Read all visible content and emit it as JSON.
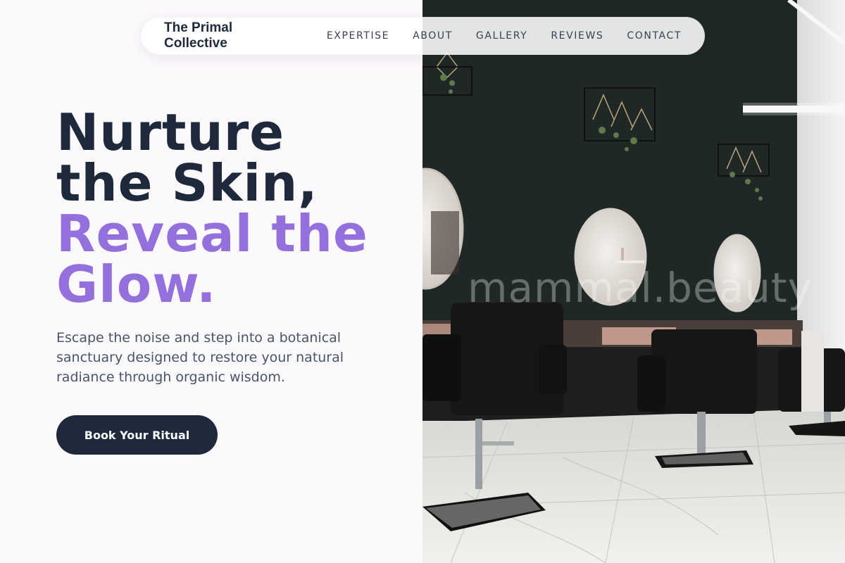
{
  "nav": {
    "brand": "The Primal Collective",
    "links": [
      "EXPERTISE",
      "ABOUT",
      "GALLERY",
      "REVIEWS",
      "CONTACT"
    ]
  },
  "hero": {
    "title_line1": "Nurture",
    "title_line2": "the Skin,",
    "title_accent_line1": "Reveal the",
    "title_accent_line2": "Glow.",
    "subtitle": "Escape the noise and step into a botanical sanctuary designed to restore your natural radiance through organic wisdom.",
    "cta_label": "Book Your Ritual"
  },
  "photo": {
    "watermark": "mammal.beauty"
  },
  "colors": {
    "primary_dark": "#1e293b",
    "accent": "#9370db",
    "background": "#fcf9fd",
    "body_text": "#475569"
  }
}
